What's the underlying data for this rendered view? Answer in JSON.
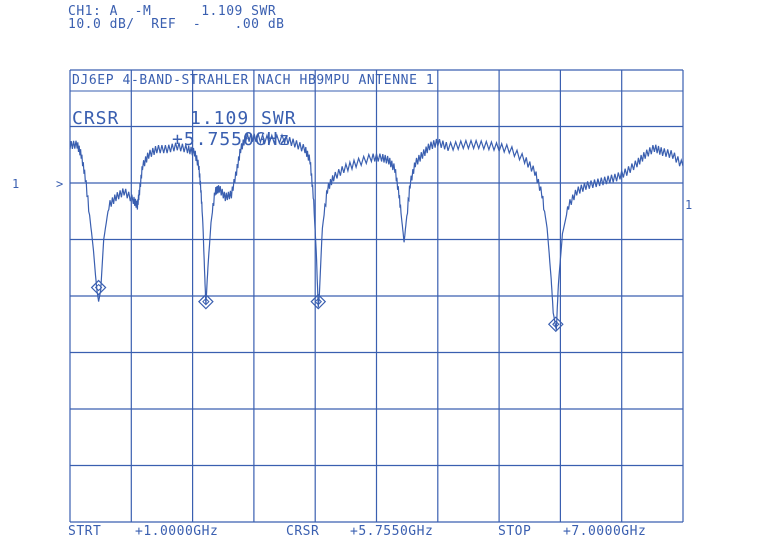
{
  "header": {
    "line1": "CH1: A  -M      1.109 SWR",
    "line2": "10.0 dB/  REF  -    .00 dB"
  },
  "plot_title": "DJ6EP  4-BAND-STRAHLER NACH HB9MPU ANTENNE 1",
  "cursor": {
    "label": "CRSR",
    "value": "1.109 SWR",
    "freq": "+5.7550GHz"
  },
  "markers": {
    "ref_left": "1",
    "ref_arrow": ">",
    "right": "1"
  },
  "footer": {
    "start_label": "STRT",
    "start_value": "+1.0000GHz",
    "cursor_label": "CRSR",
    "cursor_value": "+5.7550GHz",
    "stop_label": "STOP",
    "stop_value": "+7.0000GHz"
  },
  "colors": {
    "trace": "#3a5fb0",
    "grid": "#3a5fb0",
    "background": "#ffffff"
  },
  "chart_data": {
    "type": "line",
    "title": "DJ6EP  4-BAND-STRAHLER NACH HB9MPU ANTENNE 1",
    "xlabel": "",
    "ylabel": "",
    "xlim": [
      1.0,
      7.0
    ],
    "ylim": [
      -80,
      0
    ],
    "grid": true,
    "divisions": {
      "x": 10,
      "y": 8
    },
    "scale": "10.0 dB/",
    "reference": ".00 dB",
    "series": [
      {
        "points": [
          [
            1.0,
            -13.3
          ],
          [
            1.07,
            -13.2
          ],
          [
            1.11,
            -15.0
          ],
          [
            1.15,
            -19.0
          ],
          [
            1.2,
            -27.0
          ],
          [
            1.23,
            -32.0
          ],
          [
            1.26,
            -38.5
          ],
          [
            1.28,
            -41.0
          ],
          [
            1.3,
            -39.0
          ],
          [
            1.33,
            -30.0
          ],
          [
            1.38,
            -24.0
          ],
          [
            1.45,
            -22.5
          ],
          [
            1.53,
            -21.5
          ],
          [
            1.62,
            -23.0
          ],
          [
            1.66,
            -24.0
          ],
          [
            1.68,
            -21.5
          ],
          [
            1.71,
            -17.0
          ],
          [
            1.77,
            -15.0
          ],
          [
            1.85,
            -14.0
          ],
          [
            1.95,
            -14.0
          ],
          [
            2.05,
            -13.5
          ],
          [
            2.15,
            -14.0
          ],
          [
            2.22,
            -14.6
          ],
          [
            2.26,
            -17.0
          ],
          [
            2.28,
            -21.0
          ],
          [
            2.3,
            -27.0
          ],
          [
            2.32,
            -37.0
          ],
          [
            2.33,
            -41.5
          ],
          [
            2.35,
            -35.0
          ],
          [
            2.38,
            -27.0
          ],
          [
            2.42,
            -21.5
          ],
          [
            2.46,
            -21.0
          ],
          [
            2.52,
            -22.5
          ],
          [
            2.58,
            -22.0
          ],
          [
            2.63,
            -18.0
          ],
          [
            2.67,
            -14.0
          ],
          [
            2.72,
            -12.0
          ],
          [
            2.82,
            -12.0
          ],
          [
            2.95,
            -12.3
          ],
          [
            3.1,
            -12.2
          ],
          [
            3.2,
            -13.0
          ],
          [
            3.3,
            -14.0
          ],
          [
            3.35,
            -16.0
          ],
          [
            3.38,
            -22.0
          ],
          [
            3.41,
            -32.0
          ],
          [
            3.43,
            -42.0
          ],
          [
            3.44,
            -40.0
          ],
          [
            3.47,
            -28.0
          ],
          [
            3.52,
            -21.0
          ],
          [
            3.58,
            -19.0
          ],
          [
            3.68,
            -17.5
          ],
          [
            3.8,
            -16.5
          ],
          [
            3.95,
            -15.5
          ],
          [
            4.05,
            -15.5
          ],
          [
            4.12,
            -16.0
          ],
          [
            4.18,
            -17.5
          ],
          [
            4.22,
            -22.0
          ],
          [
            4.25,
            -27.0
          ],
          [
            4.27,
            -30.5
          ],
          [
            4.29,
            -27.0
          ],
          [
            4.33,
            -20.0
          ],
          [
            4.38,
            -16.5
          ],
          [
            4.45,
            -15.0
          ],
          [
            4.52,
            -13.5
          ],
          [
            4.6,
            -12.8
          ],
          [
            4.7,
            -13.6
          ],
          [
            4.85,
            -13.2
          ],
          [
            5.0,
            -13.2
          ],
          [
            5.15,
            -13.5
          ],
          [
            5.3,
            -14.0
          ],
          [
            5.45,
            -15.8
          ],
          [
            5.55,
            -18.0
          ],
          [
            5.62,
            -22.0
          ],
          [
            5.67,
            -28.0
          ],
          [
            5.71,
            -37.0
          ],
          [
            5.73,
            -43.0
          ],
          [
            5.76,
            -46.0
          ],
          [
            5.78,
            -38.0
          ],
          [
            5.82,
            -29.0
          ],
          [
            5.88,
            -24.0
          ],
          [
            5.96,
            -21.5
          ],
          [
            6.05,
            -20.5
          ],
          [
            6.15,
            -20.0
          ],
          [
            6.25,
            -19.5
          ],
          [
            6.35,
            -19.0
          ],
          [
            6.45,
            -18.0
          ],
          [
            6.55,
            -16.5
          ],
          [
            6.63,
            -15.0
          ],
          [
            6.72,
            -13.8
          ],
          [
            6.8,
            -14.5
          ],
          [
            6.9,
            -15.0
          ],
          [
            7.0,
            -17.0
          ]
        ]
      }
    ],
    "markers": [
      {
        "x": 1.28,
        "y": -38.5
      },
      {
        "x": 2.33,
        "y": -41.0
      },
      {
        "x": 3.43,
        "y": -41.0
      },
      {
        "x": 5.755,
        "y": -45.0
      }
    ]
  }
}
